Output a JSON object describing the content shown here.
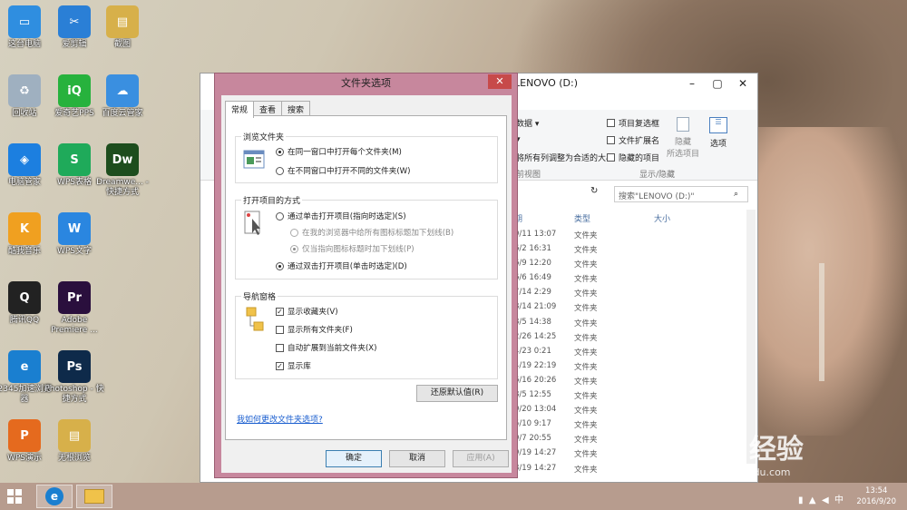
{
  "desktop": {
    "icons": [
      {
        "label": "这台电脑",
        "color": "#2f8ee0",
        "glyph": "▭"
      },
      {
        "label": "爱剪辑",
        "color": "#2a7fd6",
        "glyph": "✂"
      },
      {
        "label": "截图",
        "color": "#d7b04a",
        "glyph": "▤"
      },
      {
        "label": "回收站",
        "color": "#9fb0c0",
        "glyph": "♻"
      },
      {
        "label": "爱奇艺PPS",
        "color": "#27b23d",
        "glyph": "iQ"
      },
      {
        "label": "百度云管家",
        "color": "#3a8fe0",
        "glyph": "☁"
      },
      {
        "label": "电脑管家",
        "color": "#1c7fe0",
        "glyph": "◈"
      },
      {
        "label": "WPS表格",
        "color": "#1faa5a",
        "glyph": "S"
      },
      {
        "label": "Dreamwe... - 快捷方式",
        "color": "#1d4d1d",
        "glyph": "Dw"
      },
      {
        "label": "酷我音乐",
        "color": "#f0a020",
        "glyph": "K"
      },
      {
        "label": "WPS文字",
        "color": "#2a86e0",
        "glyph": "W"
      },
      {
        "label": "腾讯QQ",
        "color": "#222222",
        "glyph": "Q"
      },
      {
        "label": "Adobe Premiere ...",
        "color": "#2a0f3d",
        "glyph": "Pr"
      },
      {
        "label": "2345加速浏览器",
        "color": "#1a7fd0",
        "glyph": "e"
      },
      {
        "label": "Photoshop - 快捷方式",
        "color": "#0e2a4a",
        "glyph": "Ps"
      },
      {
        "label": "WPS演示",
        "color": "#e56a1e",
        "glyph": "P"
      },
      {
        "label": "无根浏览",
        "color": "#d7b04a",
        "glyph": "▤"
      }
    ]
  },
  "explorer": {
    "title": "LENOVO (D:)",
    "search_placeholder": "搜索\"LENOVO (D:)\"",
    "ribbon": {
      "data_label": "数据 ▾",
      "fit_label": "将所有列调整为合适的大小",
      "view_label": "前视图",
      "item_checkbox": "项目复选框",
      "file_ext": "文件扩展名",
      "hidden_items": "隐藏的项目",
      "hide_btn": "隐藏",
      "hide_selected": "所选项目",
      "options_btn": "选项",
      "group_label": "显示/隐藏"
    },
    "columns": {
      "date": "期",
      "type": "类型",
      "size": "大小"
    },
    "rows": [
      {
        "date": "9/11 13:07",
        "type": "文件夹"
      },
      {
        "date": "6/2 16:31",
        "type": "文件夹"
      },
      {
        "date": "6/9 12:20",
        "type": "文件夹"
      },
      {
        "date": "6/6 16:49",
        "type": "文件夹"
      },
      {
        "date": "7/14 2:29",
        "type": "文件夹"
      },
      {
        "date": "8/14 21:09",
        "type": "文件夹"
      },
      {
        "date": "8/5 14:38",
        "type": "文件夹"
      },
      {
        "date": "2/26 14:25",
        "type": "文件夹"
      },
      {
        "date": "4/23 0:21",
        "type": "文件夹"
      },
      {
        "date": "4/19 22:19",
        "type": "文件夹"
      },
      {
        "date": "6/16 20:26",
        "type": "文件夹"
      },
      {
        "date": "8/5 12:55",
        "type": "文件夹"
      },
      {
        "date": "9/20 13:04",
        "type": "文件夹"
      },
      {
        "date": "5/10 9:17",
        "type": "文件夹"
      },
      {
        "date": "9/7 20:55",
        "type": "文件夹"
      },
      {
        "date": "9/19 14:27",
        "type": "文件夹"
      },
      {
        "date": "8/19 14:27",
        "type": "文件夹"
      }
    ]
  },
  "dialog": {
    "title": "文件夹选项",
    "close": "✕",
    "tabs": [
      "常规",
      "查看",
      "搜索"
    ],
    "browse": {
      "title": "浏览文件夹",
      "opt1": "在同一窗口中打开每个文件夹(M)",
      "opt2": "在不同窗口中打开不同的文件夹(W)"
    },
    "click": {
      "title": "打开项目的方式",
      "opt1": "通过单击打开项目(指向时选定)(S)",
      "sub1": "在我的浏览器中给所有图标标题加下划线(B)",
      "sub2": "仅当指向图标标题时加下划线(P)",
      "opt2": "通过双击打开项目(单击时选定)(D)"
    },
    "nav": {
      "title": "导航窗格",
      "c1": "显示收藏夹(V)",
      "c2": "显示所有文件夹(F)",
      "c3": "自动扩展到当前文件夹(X)",
      "c4": "显示库"
    },
    "restore": "还原默认值(R)",
    "help_link": "我如何更改文件夹选项?",
    "ok": "确定",
    "cancel": "取消",
    "apply": "应用(A)"
  },
  "taskbar": {
    "time": "13:54",
    "date": "2016/9/20",
    "ime": "中"
  },
  "watermark": {
    "text": "Bai 经验",
    "url": "jingyan.baidu.com"
  }
}
